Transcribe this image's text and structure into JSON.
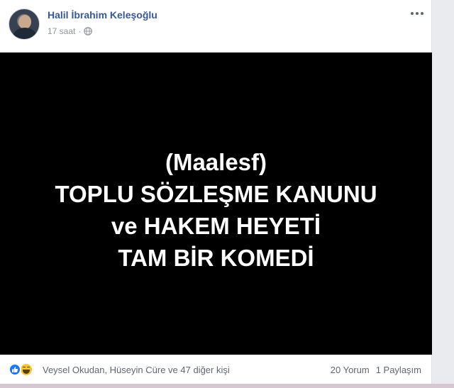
{
  "post": {
    "author": "Halil İbrahim Keleşoğlu",
    "time": "17 saat",
    "separator": "·",
    "privacy_icon": "globe-icon",
    "more_icon": "more-options-icon",
    "image_text": {
      "line1": "(Maalesf)",
      "line2": "TOPLU SÖZLEŞME KANUNU",
      "line3": "ve HAKEM HEYETİ",
      "line4": "TAM BİR KOMEDİ"
    },
    "image_background": "#000000"
  },
  "footer": {
    "reactions": [
      "like-icon",
      "haha-icon"
    ],
    "reaction_names": "Veysel Okudan, Hüseyin Cüre ve 47 diğer kişi",
    "comments": "20 Yorum",
    "shares": "1 Paylaşım"
  },
  "colors": {
    "author_link": "#385898",
    "meta_text": "#90949c",
    "like_blue": "#1877f2",
    "haha_yellow": "#f7c33a"
  }
}
